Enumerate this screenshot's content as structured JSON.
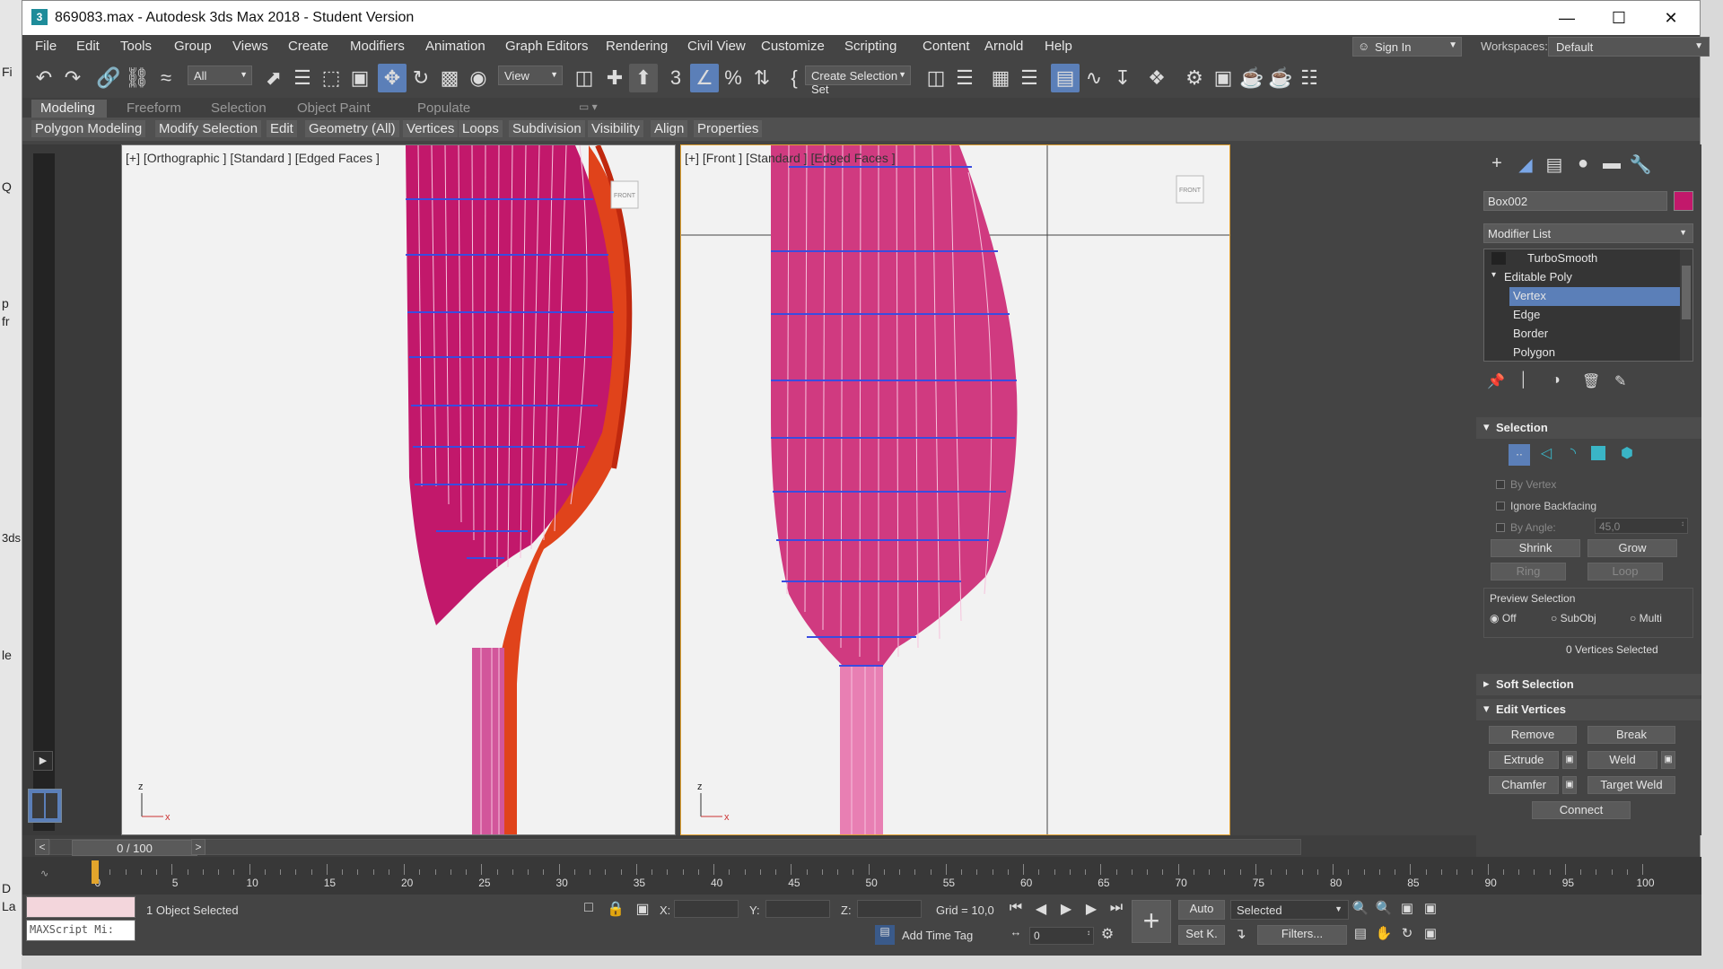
{
  "window": {
    "title": "869083.max - Autodesk 3ds Max 2018 - Student Version",
    "icon": "3"
  },
  "desktop_labels": [
    "Fi",
    "Q",
    "p",
    "fr",
    "3ds",
    "le",
    "D",
    "La"
  ],
  "menu": [
    "File",
    "Edit",
    "Tools",
    "Group",
    "Views",
    "Create",
    "Modifiers",
    "Animation",
    "Graph Editors",
    "Rendering",
    "Civil View",
    "Customize",
    "Scripting",
    "Content",
    "Arnold",
    "Help"
  ],
  "signin": "Sign In",
  "workspaces": {
    "label": "Workspaces:",
    "value": "Default"
  },
  "toolbar": {
    "filter": "All",
    "view": "View",
    "selection_set": "Create Selection Set"
  },
  "ribbon_tabs": [
    "Modeling",
    "Freeform",
    "Selection",
    "Object Paint",
    "Populate"
  ],
  "ribbon_items": [
    "Polygon Modeling",
    "Modify Selection",
    "Edit",
    "Geometry (All)",
    "Vertices",
    "Loops",
    "Subdivision",
    "Visibility",
    "Align",
    "Properties"
  ],
  "viewports": {
    "left": {
      "label": "[+] [Orthographic ] [Standard ] [Edged Faces ]",
      "cube": "FRONT"
    },
    "right": {
      "label": "[+] [Front ] [Standard ] [Edged Faces ]",
      "cube": "FRONT"
    }
  },
  "command_panel": {
    "object_name": "Box002",
    "object_color": "#c2186b",
    "modifier_list": "Modifier List",
    "stack": [
      {
        "label": "TurboSmooth",
        "level": 0
      },
      {
        "label": "Editable Poly",
        "level": 0
      },
      {
        "label": "Vertex",
        "level": 1,
        "selected": true
      },
      {
        "label": "Edge",
        "level": 1
      },
      {
        "label": "Border",
        "level": 1
      },
      {
        "label": "Polygon",
        "level": 1
      }
    ],
    "selection": {
      "title": "Selection",
      "by_vertex": "By Vertex",
      "ignore_backfacing": "Ignore Backfacing",
      "by_angle": "By Angle:",
      "angle_value": "45,0",
      "shrink": "Shrink",
      "grow": "Grow",
      "ring": "Ring",
      "loop": "Loop",
      "preview_selection": "Preview Selection",
      "preview_options": [
        "Off",
        "SubObj",
        "Multi"
      ],
      "status": "0 Vertices Selected"
    },
    "soft_selection": "Soft Selection",
    "edit_vertices": {
      "title": "Edit Vertices",
      "remove": "Remove",
      "break": "Break",
      "extrude": "Extrude",
      "weld": "Weld",
      "chamfer": "Chamfer",
      "target_weld": "Target Weld",
      "connect": "Connect"
    }
  },
  "time_slider": {
    "value": "0 / 100",
    "prev": "<",
    "next": ">"
  },
  "trackbar_ticks": [
    "0",
    "5",
    "10",
    "15",
    "20",
    "25",
    "30",
    "35",
    "40",
    "45",
    "50",
    "55",
    "60",
    "65",
    "70",
    "75",
    "80",
    "85",
    "90",
    "95",
    "100"
  ],
  "status": {
    "maxscript": "MAXScript Mi:",
    "objects": "1 Object Selected",
    "x_label": "X:",
    "y_label": "Y:",
    "z_label": "Z:",
    "grid": "Grid = 10,0",
    "add_time_tag": "Add Time Tag",
    "auto": "Auto",
    "selected": "Selected",
    "setk": "Set K.",
    "filters": "Filters...",
    "frame": "0"
  }
}
